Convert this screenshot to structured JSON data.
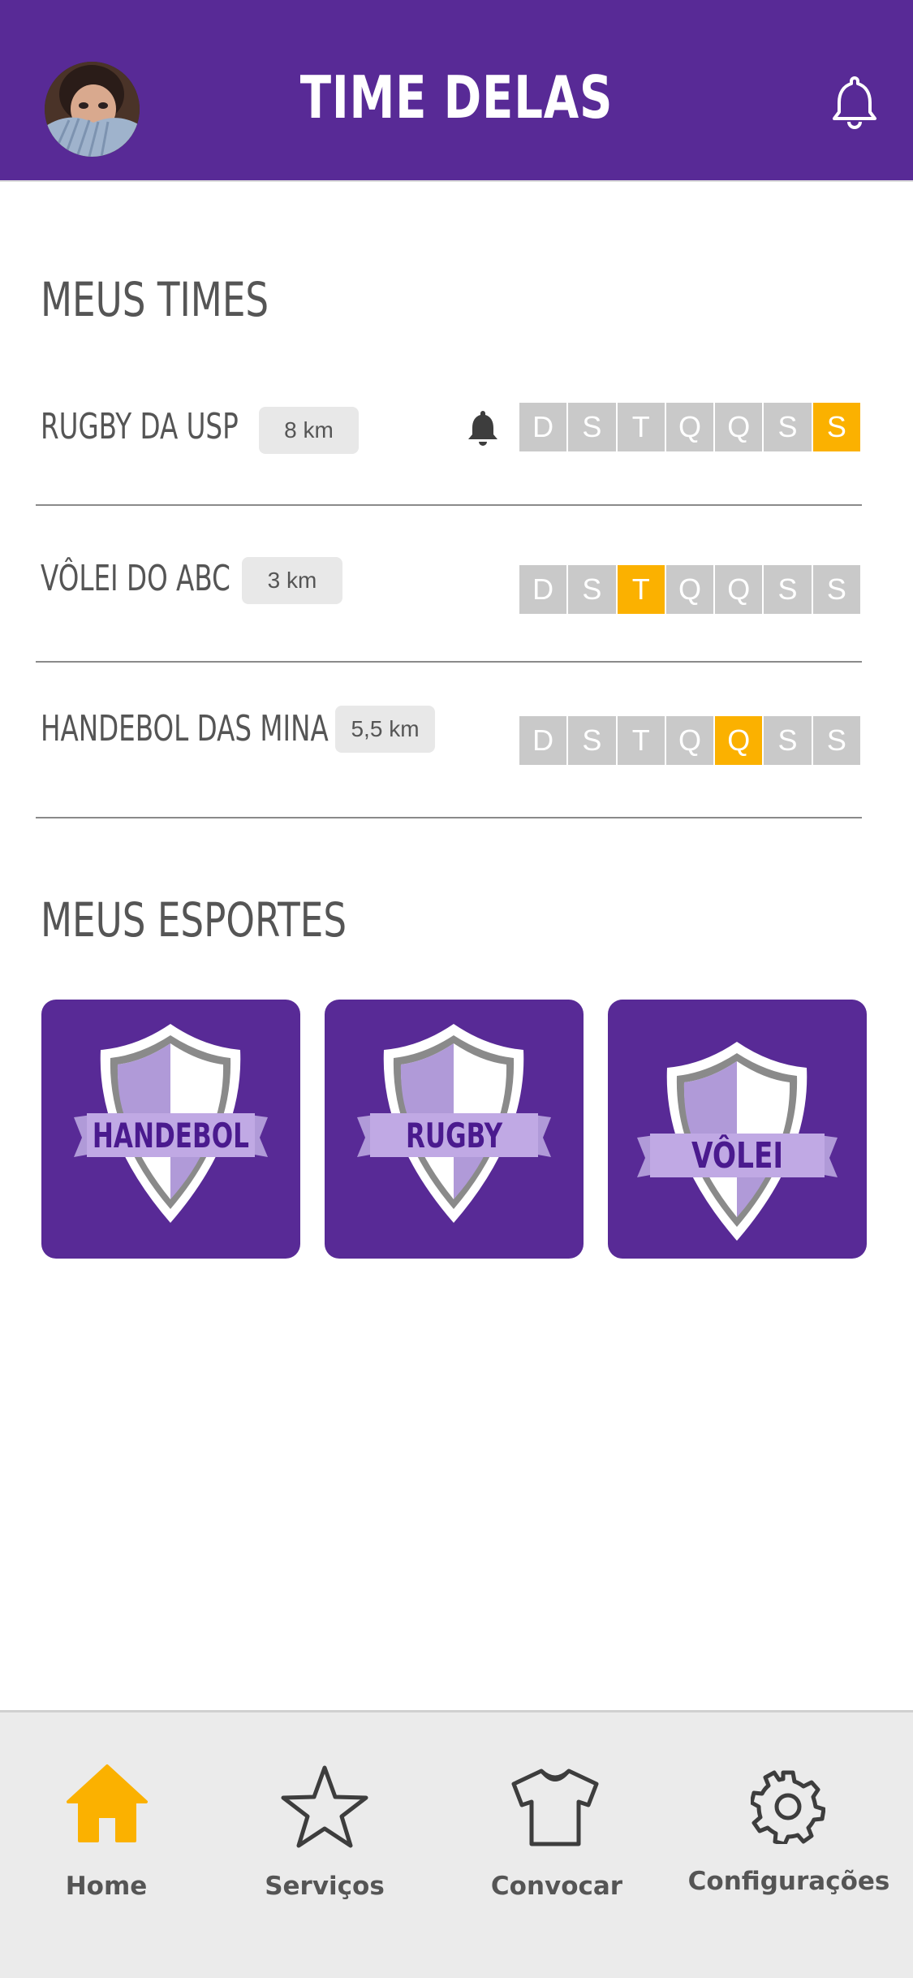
{
  "header": {
    "title": "TIME DELAS",
    "avatar": "user-avatar-photo",
    "notification_icon": "bell-icon"
  },
  "meus_times": {
    "title": "MEUS TIMES",
    "teams": [
      {
        "name": "RUGBY DA USP",
        "distance": "8 km",
        "has_notification": true,
        "days": [
          "D",
          "S",
          "T",
          "Q",
          "Q",
          "S",
          "S"
        ],
        "active_day_index": 6
      },
      {
        "name": "VÔLEI DO ABC",
        "distance": "3 km",
        "has_notification": false,
        "days": [
          "D",
          "S",
          "T",
          "Q",
          "Q",
          "S",
          "S"
        ],
        "active_day_index": 2
      },
      {
        "name": "HANDEBOL DAS MINA",
        "distance": "5,5 km",
        "has_notification": false,
        "days": [
          "D",
          "S",
          "T",
          "Q",
          "Q",
          "S",
          "S"
        ],
        "active_day_index": 4
      }
    ]
  },
  "meus_esportes": {
    "title": "MEUS ESPORTES",
    "sports": [
      {
        "label": "HANDEBOL"
      },
      {
        "label": "RUGBY"
      },
      {
        "label": "VÔLEI"
      }
    ]
  },
  "bottom_nav": {
    "items": [
      {
        "label": "Home",
        "icon": "home-icon",
        "active": true
      },
      {
        "label": "Serviços",
        "icon": "star-icon",
        "active": false
      },
      {
        "label": "Convocar",
        "icon": "shirt-icon",
        "active": false
      },
      {
        "label": "Configurações",
        "icon": "gear-icon",
        "active": false
      }
    ]
  },
  "colors": {
    "brand_purple": "#582a96",
    "accent_yellow": "#fbb100",
    "day_inactive": "#c9c9c9",
    "text_gray": "#555555"
  }
}
